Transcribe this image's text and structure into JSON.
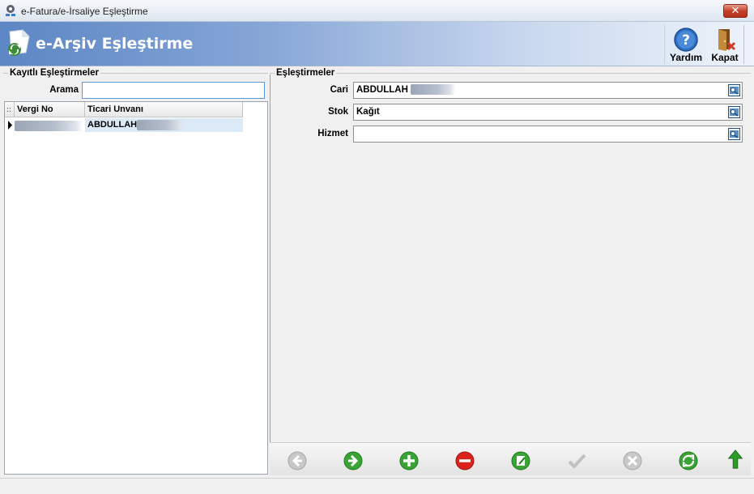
{
  "window": {
    "title": "e-Fatura/e-İrsaliye Eşleştirme",
    "close_label": "✕"
  },
  "header": {
    "title": "e-Arşiv Eşleştirme",
    "buttons": {
      "help": "Yardım",
      "close": "Kapat"
    }
  },
  "left": {
    "group_title": "Kayıtlı Eşleştirmeler",
    "search_label": "Arama",
    "search_value": "",
    "grid": {
      "columns": [
        "Vergi No",
        "Ticari Unvanı"
      ],
      "rows": [
        {
          "vergi_no": "",
          "ticari_unvani": "ABDULLAH"
        }
      ]
    }
  },
  "right": {
    "group_title": "Eşleştirmeler",
    "fields": {
      "cari": {
        "label": "Cari",
        "value": "ABDULLAH"
      },
      "stok": {
        "label": "Stok",
        "value": "Kağıt"
      },
      "hizmet": {
        "label": "Hizmet",
        "value": ""
      }
    }
  },
  "toolbar_icons": [
    "back-icon",
    "forward-icon",
    "add-icon",
    "delete-icon",
    "edit-icon",
    "confirm-icon",
    "cancel-icon",
    "refresh-icon",
    "up-arrow-icon"
  ],
  "colors": {
    "header_start": "#5c86c4",
    "selection": "#dce9f7",
    "focus_border": "#5b9bd5"
  }
}
